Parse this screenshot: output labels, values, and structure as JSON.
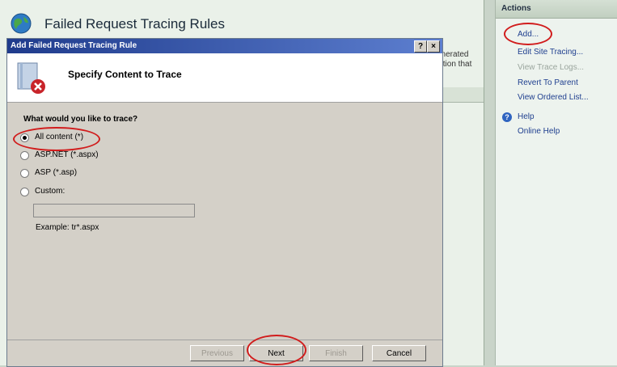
{
  "page": {
    "title": "Failed Request Tracing Rules",
    "bg_text_line1": "enerated",
    "bg_text_line2": "dition that"
  },
  "actions": {
    "header": "Actions",
    "items": [
      {
        "label": "Add...",
        "enabled": true,
        "highlighted": true
      },
      {
        "label": "Edit Site Tracing...",
        "enabled": true
      },
      {
        "label": "View Trace Logs...",
        "enabled": false
      },
      {
        "label": "Revert To Parent",
        "enabled": true
      },
      {
        "label": "View Ordered List...",
        "enabled": true
      }
    ],
    "help": [
      {
        "label": "Help",
        "icon": "help-icon"
      },
      {
        "label": "Online Help"
      }
    ]
  },
  "dialog": {
    "title": "Add Failed Request Tracing Rule",
    "help_button": "?",
    "close_button": "×",
    "heading": "Specify Content to Trace",
    "question": "What would you like to trace?",
    "options": [
      {
        "label": "All content (*)",
        "selected": true
      },
      {
        "label": "ASP.NET (*.aspx)",
        "selected": false
      },
      {
        "label": "ASP (*.asp)",
        "selected": false
      },
      {
        "label": "Custom:",
        "selected": false
      }
    ],
    "custom_value": "",
    "example": "Example: tr*.aspx",
    "buttons": {
      "previous": "Previous",
      "next": "Next",
      "finish": "Finish",
      "cancel": "Cancel"
    }
  },
  "colors": {
    "highlight": "#d11c1c",
    "titlebar": "#1f3b8c",
    "link": "#1f3f8f"
  }
}
